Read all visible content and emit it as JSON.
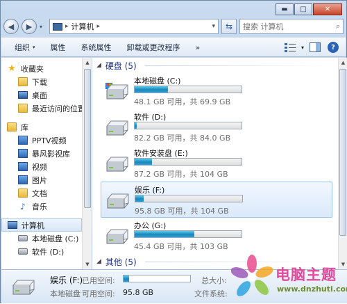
{
  "window": {
    "caption_buttons": {
      "minimize": "▬",
      "maximize": "□",
      "close": "✕"
    }
  },
  "navbar": {
    "back_icon": "◀",
    "forward_icon": "▶",
    "dropdown_icon": "▾",
    "address": {
      "sep": "▸",
      "path": "计算机",
      "arrow": "▸",
      "dropdown": "▾"
    },
    "refresh_icon": "⇆",
    "search": {
      "placeholder": "搜索 计算机",
      "icon": "⌕"
    }
  },
  "toolbar": {
    "organize": "组织",
    "organize_dd": "▾",
    "properties": "属性",
    "system_properties": "系统属性",
    "uninstall": "卸载或更改程序",
    "more": "»",
    "view_dd": "▾",
    "help": "?"
  },
  "sidebar": {
    "scroll_up": "▲",
    "scroll_down": "▼",
    "favorites": {
      "label": "收藏夹",
      "items": [
        {
          "label": "下载",
          "icon": "download-folder-icon"
        },
        {
          "label": "桌面",
          "icon": "desktop-icon"
        },
        {
          "label": "最近访问的位置",
          "icon": "recent-places-icon"
        }
      ]
    },
    "libraries": {
      "label": "库",
      "items": [
        {
          "label": "PPTV视频",
          "icon": "video-library-icon"
        },
        {
          "label": "暴风影视库",
          "icon": "video-library-icon"
        },
        {
          "label": "视频",
          "icon": "videos-icon"
        },
        {
          "label": "图片",
          "icon": "pictures-icon"
        },
        {
          "label": "文档",
          "icon": "documents-icon"
        },
        {
          "label": "音乐",
          "icon": "music-icon"
        }
      ]
    },
    "computer": {
      "label": "计算机",
      "items": [
        {
          "label": "本地磁盘 (C:)"
        },
        {
          "label": "软件 (D:)"
        }
      ]
    }
  },
  "content": {
    "scroll_up": "▲",
    "scroll_down": "▼",
    "hard_disks": {
      "header_icon": "◢",
      "header": "硬盘 (5)",
      "drives": [
        {
          "name": "本地磁盘 (C:)",
          "free_text": "48.1 GB 可用，共 69.9 GB",
          "used_fraction": 0.31,
          "selected": false
        },
        {
          "name": "软件 (D:)",
          "free_text": "82.2 GB 可用，共 84.0 GB",
          "used_fraction": 0.02,
          "selected": false
        },
        {
          "name": "软件安装盘 (E:)",
          "free_text": "87.2 GB 可用，共 104 GB",
          "used_fraction": 0.16,
          "selected": false
        },
        {
          "name": "娱乐 (F:)",
          "free_text": "95.8 GB 可用，共 104 GB",
          "used_fraction": 0.08,
          "selected": true
        },
        {
          "name": "办公 (G:)",
          "free_text": "45.4 GB 可用，共 103 GB",
          "used_fraction": 0.56,
          "selected": false
        }
      ]
    },
    "other": {
      "header_icon": "◢",
      "header": "其他 (5)"
    }
  },
  "status": {
    "name": "娱乐 (F:)",
    "used_label": "已用空间:",
    "used_fraction": 0.08,
    "type": "本地磁盘",
    "free_label": "可用空间:",
    "free_value": "95.8 GB",
    "total_label": "总大小:",
    "fs_label": "文件系统:"
  },
  "watermark": {
    "title": "电脑主题",
    "url": "www.dnzhuti.com"
  },
  "colors": {
    "accent": "#1e3287",
    "bar_fill": "#1a86bf",
    "watermark_pink": "#e04a9a",
    "watermark_green": "#6d8f2a"
  }
}
